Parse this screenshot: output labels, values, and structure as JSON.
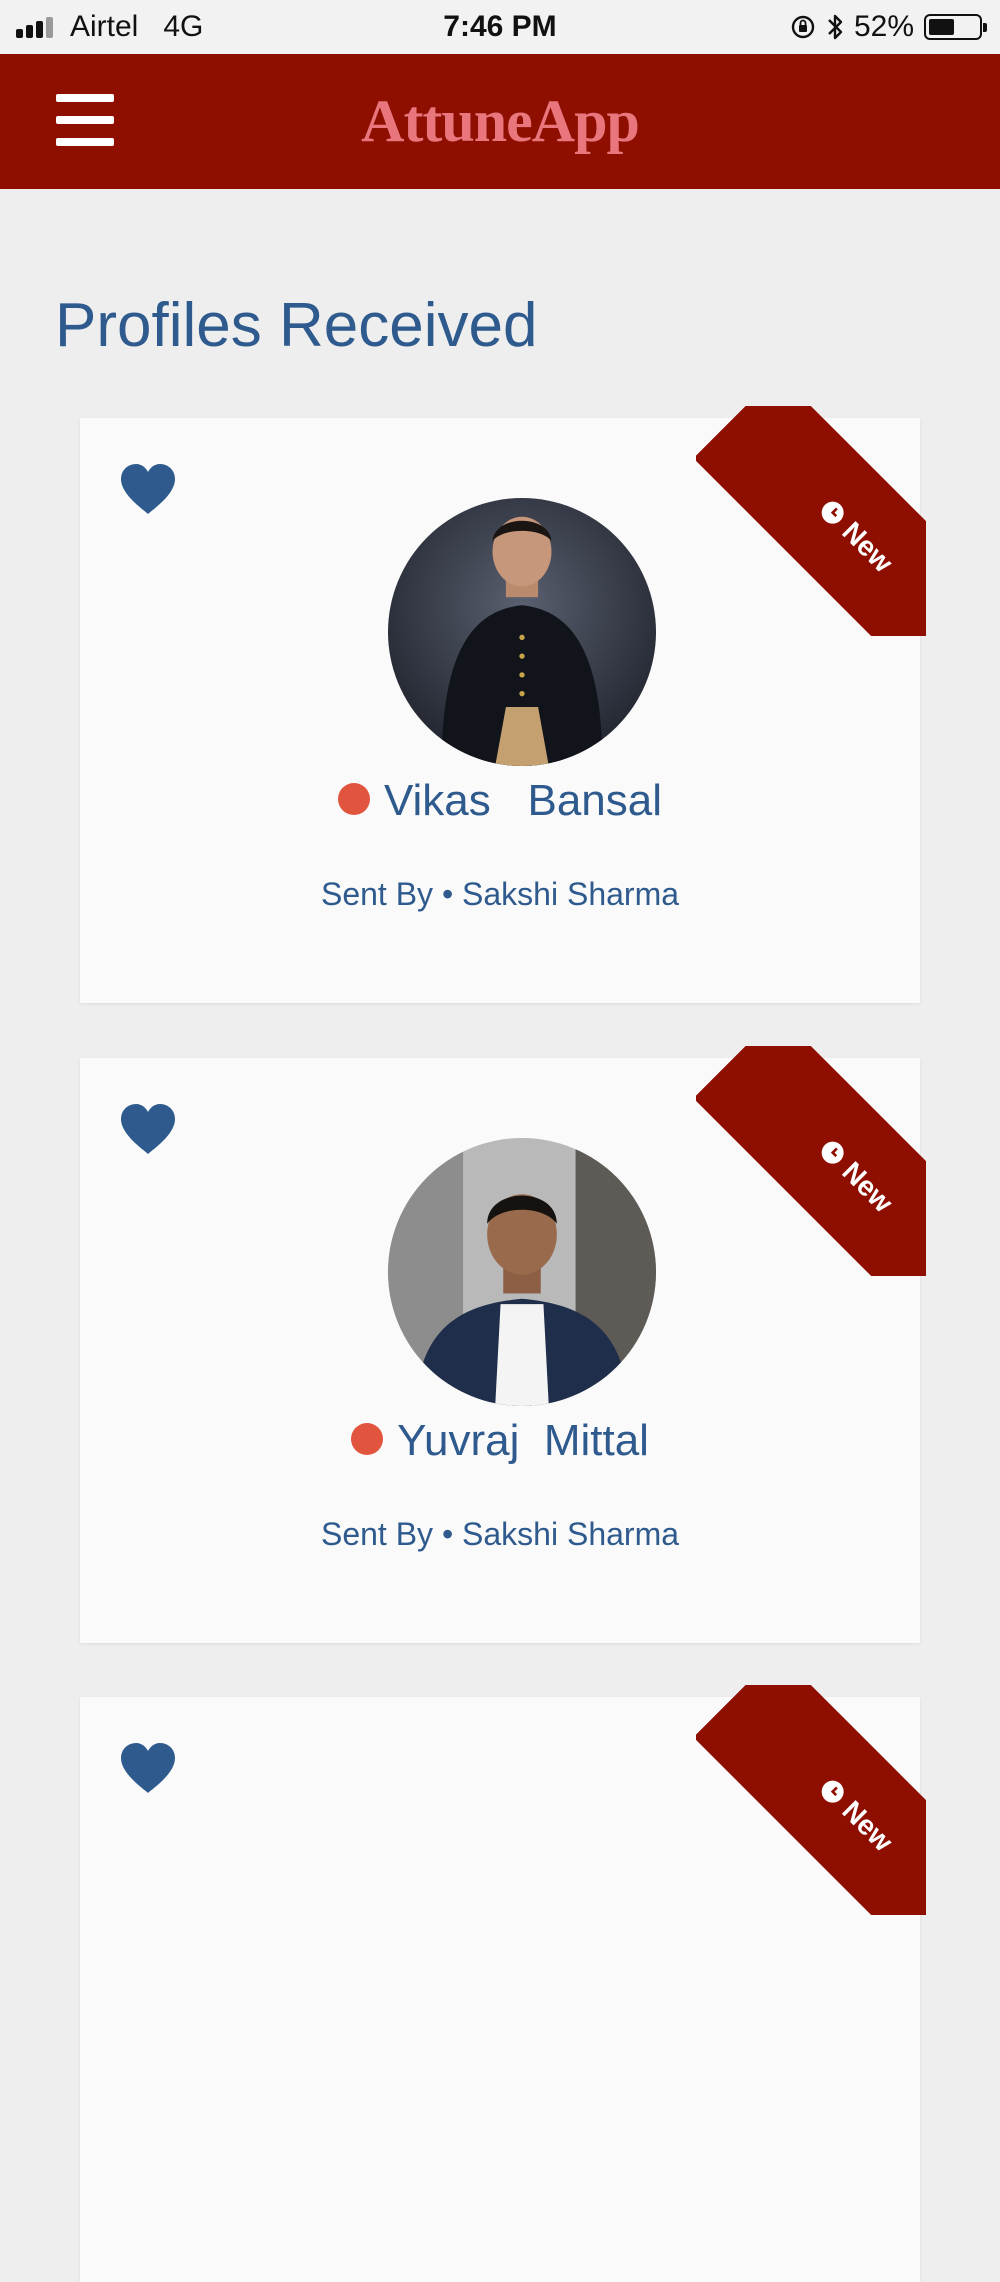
{
  "status_bar": {
    "carrier": "Airtel",
    "network": "4G",
    "time": "7:46 PM",
    "battery_text": "52%",
    "battery_level": 0.52
  },
  "header": {
    "logo_text": "AttuneApp",
    "menu_icon": "hamburger-menu-icon"
  },
  "page": {
    "title": "Profiles Received"
  },
  "profiles": [
    {
      "badge": "New",
      "first_name": "Vikas",
      "last_name": "Bansal",
      "sent_by_label": "Sent By",
      "sender": "Sakshi Sharma",
      "status_color": "#e1543e"
    },
    {
      "badge": "New",
      "first_name": "Yuvraj",
      "last_name": "Mittal",
      "sent_by_label": "Sent By",
      "sender": "Sakshi Sharma",
      "status_color": "#e1543e"
    },
    {
      "badge": "New"
    }
  ],
  "colors": {
    "brand_red": "#8e0e00",
    "text_blue": "#2e5a8e",
    "status_dot": "#e1543e",
    "heart_blue": "#2e5a8e"
  }
}
